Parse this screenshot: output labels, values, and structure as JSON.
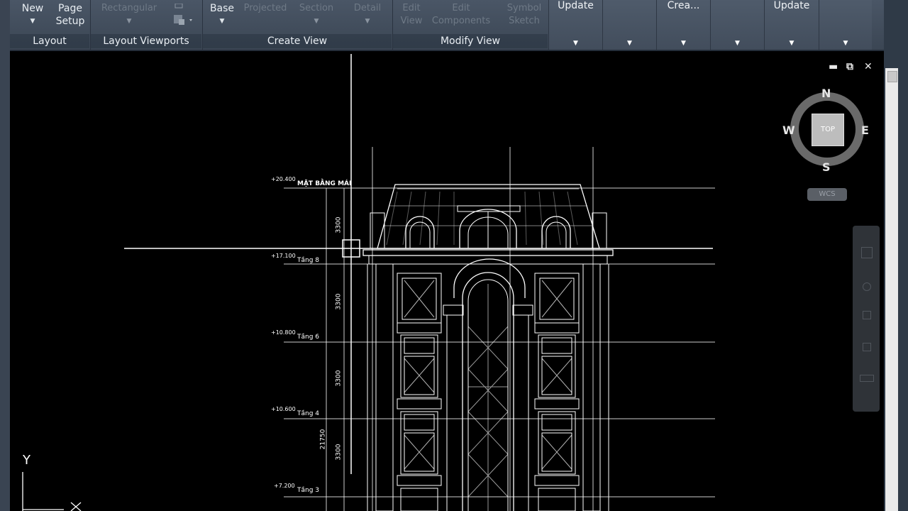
{
  "ribbon": {
    "new_label": "New",
    "page_setup_line1": "Page",
    "page_setup_line2": "Setup",
    "rectangular_label": "Rectangular",
    "base_label": "Base",
    "projected_label": "Projected",
    "section_label": "Section",
    "detail_label": "Detail",
    "edit_view_line1": "Edit",
    "edit_view_line2": "View",
    "edit_components_line1": "Edit",
    "edit_components_line2": "Components",
    "symbol_sketch_line1": "Symbol",
    "symbol_sketch_line2": "Sketch",
    "groups": {
      "layout": "Layout",
      "layout_viewports": "Layout Viewports",
      "create_view": "Create View",
      "modify_view": "Modify View"
    },
    "panels": [
      "Update",
      "",
      "Crea...",
      "",
      "Update",
      ""
    ]
  },
  "viewcube": {
    "north": "N",
    "south": "S",
    "east": "E",
    "west": "W",
    "face": "TOP",
    "ucs": "WCS"
  },
  "ucs_icon": {
    "y": "Y",
    "x": "X"
  },
  "drawing": {
    "levels": [
      {
        "elev": "+20.400",
        "name": "MẶT BẰNG MÁI"
      },
      {
        "elev": "+17.100",
        "name": "Tầng 8"
      },
      {
        "elev": "+10.800",
        "name": "Tầng 6"
      },
      {
        "elev": "+10.600",
        "name": "Tầng 4"
      },
      {
        "elev": "+7.200",
        "name": "Tầng 3"
      }
    ],
    "dimensions": [
      "3300",
      "3300",
      "3300",
      "3300",
      "21750"
    ]
  },
  "colors": {
    "canvas": "#000000",
    "ribbon": "#434e5c",
    "linework": "#ffffff"
  }
}
